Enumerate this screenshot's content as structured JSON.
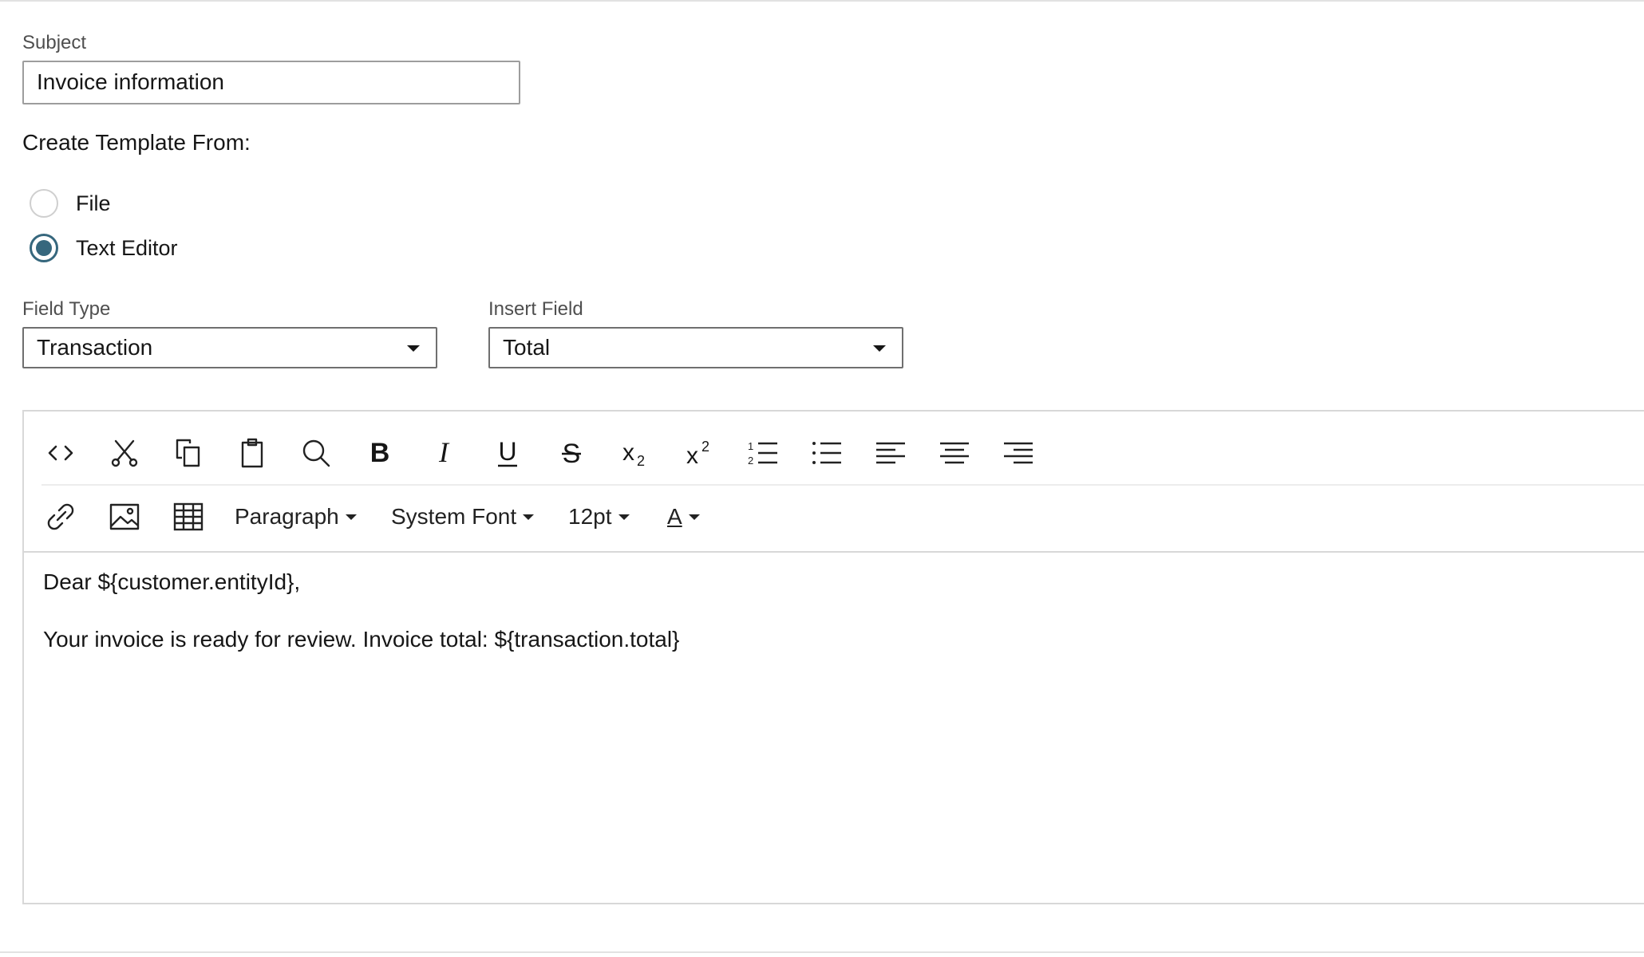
{
  "subject": {
    "label": "Subject",
    "value": "Invoice information"
  },
  "template_source": {
    "title": "Create Template From:",
    "options": [
      {
        "label": "File",
        "selected": false
      },
      {
        "label": "Text Editor",
        "selected": true
      }
    ]
  },
  "field_type": {
    "label": "Field Type",
    "value": "Transaction"
  },
  "insert_field": {
    "label": "Insert Field",
    "value": "Total"
  },
  "toolbar": {
    "row1_icons": [
      "source-code-icon",
      "cut-icon",
      "copy-icon",
      "paste-icon",
      "search-icon",
      "bold-icon",
      "italic-icon",
      "underline-icon",
      "strikethrough-icon",
      "subscript-icon",
      "superscript-icon",
      "numbered-list-icon",
      "bullet-list-icon",
      "align-left-icon",
      "align-center-icon",
      "align-right-icon"
    ],
    "row2_icons": [
      "link-icon",
      "image-icon",
      "table-icon"
    ],
    "block_format": "Paragraph",
    "font_family": "System Font",
    "font_size": "12pt",
    "text_color_glyph": "A"
  },
  "editor": {
    "line1": "Dear ${customer.entityId},",
    "line2": "Your invoice is ready for review. Invoice total: ${transaction.total}"
  },
  "colors": {
    "radio_accent": "#36677d"
  }
}
